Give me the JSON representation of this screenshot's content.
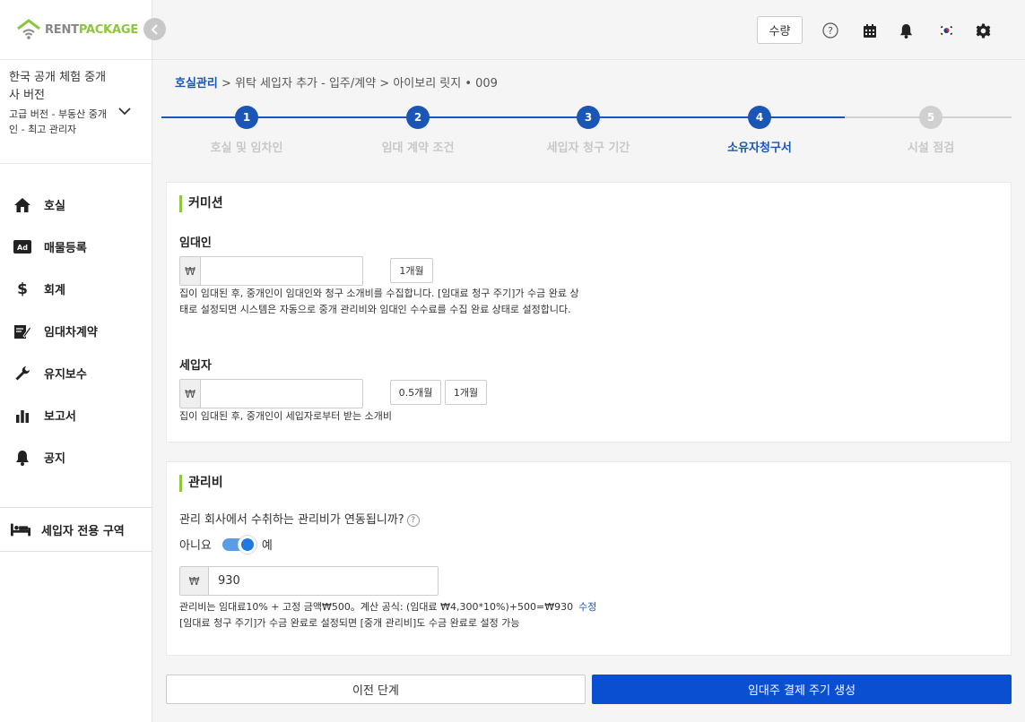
{
  "brand": {
    "rent": "RENT",
    "package": "PACKAGE",
    "accent": "#8cc63f"
  },
  "company": {
    "name": "한국 공개 체험 중개사 버전",
    "plan": "고급 버전 - 부동산 중개인 - 최고 관리자"
  },
  "sidebar": {
    "items": [
      {
        "label": "호실",
        "icon": "home-icon"
      },
      {
        "label": "매물등록",
        "icon": "ad-icon"
      },
      {
        "label": "회계",
        "icon": "dollar-icon"
      },
      {
        "label": "임대차계약",
        "icon": "contract-sign-icon"
      },
      {
        "label": "유지보수",
        "icon": "wrench-icon"
      },
      {
        "label": "보고서",
        "icon": "bar-chart-icon"
      },
      {
        "label": "공지",
        "icon": "bell-icon"
      }
    ],
    "tenant_area": "세입자 전용 구역"
  },
  "header": {
    "qty_label": "수량",
    "icons": [
      "help-icon",
      "calendar-icon",
      "bell-icon",
      "korea-flag-icon",
      "gear-icon"
    ]
  },
  "breadcrumb": {
    "root": "호실관리",
    "path": " > 위탁 세입자 추가 - 입주/계약 > 아이보리 릿지 • 009"
  },
  "steps": [
    {
      "num": "1",
      "label": "호실 및 임차인",
      "state": "done"
    },
    {
      "num": "2",
      "label": "임대 계약 조건",
      "state": "done"
    },
    {
      "num": "3",
      "label": "세입자 청구 기간",
      "state": "done"
    },
    {
      "num": "4",
      "label": "소유자청구서",
      "state": "active"
    },
    {
      "num": "5",
      "label": "시설 점검",
      "state": "todo"
    }
  ],
  "commission": {
    "title": "커미션",
    "landlord": {
      "label": "임대인",
      "currency": "₩",
      "value": "",
      "btn1": "1개월",
      "help": "집이 임대된 후, 중개인이 임대인와 청구 소개비를 수집합니다. [임대료 청구 주기]가 수금 완료 상태로 설정되면 시스템은 자동으로 중개 관리비와 임대인 수수료를 수집 완료 상태로 설정합니다."
    },
    "tenant": {
      "label": "세입자",
      "currency": "₩",
      "value": "",
      "btn1": "0.5개월",
      "btn2": "1개월",
      "help": "집이 임대된 후, 중개인이 세입자로부터 받는 소개비"
    }
  },
  "mgmt": {
    "title": "관리비",
    "question": "관리 회사에서 수취하는 관리비가 연동됩니까?",
    "no": "아니요",
    "yes": "예",
    "toggle_on": true,
    "currency": "₩",
    "value": "930",
    "formula": "관리비는 임대료10% + 고정 금액₩500。계산 공식: (임대료 ₩4,300*10%)+500=₩930",
    "edit": "수정",
    "note": "[임대료 청구 주기]가 수금 완료로 설정되면 [중개 관리비]도 수금 완료로 설정 가능"
  },
  "footer": {
    "prev": "이전 단계",
    "next": "임대주 결제 주기 생성"
  },
  "colors": {
    "primary": "#0b4fd1",
    "step_done": "#1a56b5",
    "step_todo": "#d0d0d0"
  }
}
